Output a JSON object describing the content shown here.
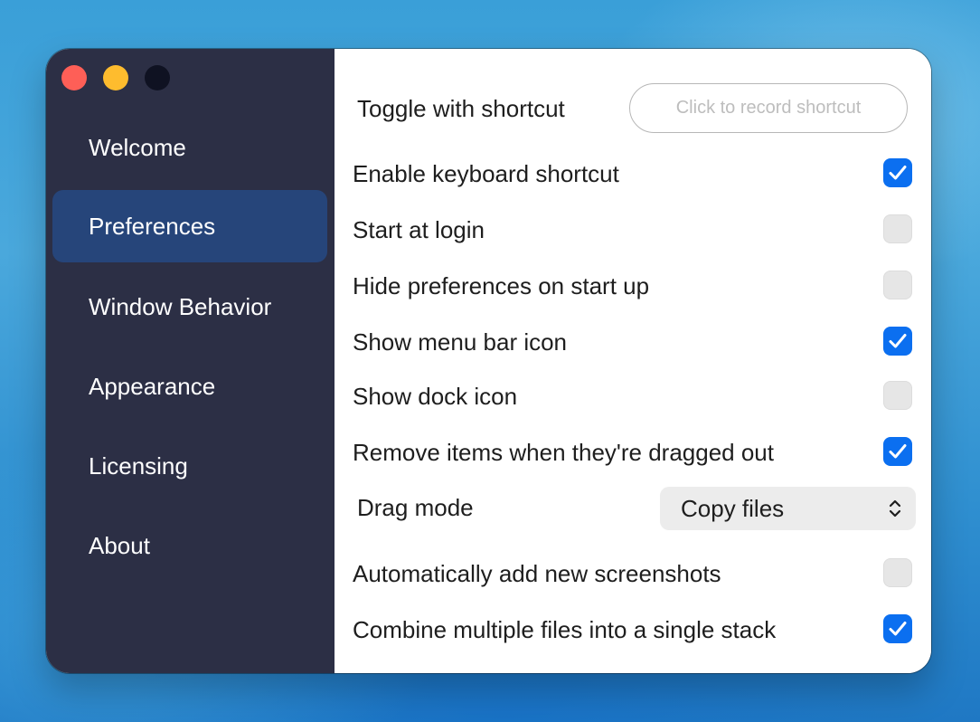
{
  "sidebar": {
    "items": [
      {
        "label": "Welcome"
      },
      {
        "label": "Preferences"
      },
      {
        "label": "Window Behavior"
      },
      {
        "label": "Appearance"
      },
      {
        "label": "Licensing"
      },
      {
        "label": "About"
      }
    ],
    "active": "Preferences"
  },
  "preferences": {
    "toggle_shortcut_label": "Toggle with shortcut",
    "record_shortcut_button": "Click to record shortcut",
    "options": [
      {
        "label": "Enable keyboard shortcut",
        "checked": true
      },
      {
        "label": "Start at login",
        "checked": false
      },
      {
        "label": "Hide preferences on start up",
        "checked": false
      },
      {
        "label": "Show menu bar icon",
        "checked": true
      },
      {
        "label": "Show dock icon",
        "checked": false
      },
      {
        "label": "Remove items when they're dragged out",
        "checked": true
      },
      {
        "label": "Automatically add new screenshots",
        "checked": false
      },
      {
        "label": "Combine multiple files into a single stack",
        "checked": true
      }
    ],
    "drag_mode_label": "Drag mode",
    "drag_mode_value": "Copy files"
  },
  "colors": {
    "sidebar_bg": "#2c2f45",
    "sidebar_active": "#26457a",
    "checkbox_on": "#0b6ff0",
    "close": "#fe5f57",
    "minimize": "#febc2e"
  },
  "icons": [
    "close-button",
    "minimize-button",
    "zoom-button",
    "checkmark-icon",
    "chevron-updown-icon"
  ]
}
